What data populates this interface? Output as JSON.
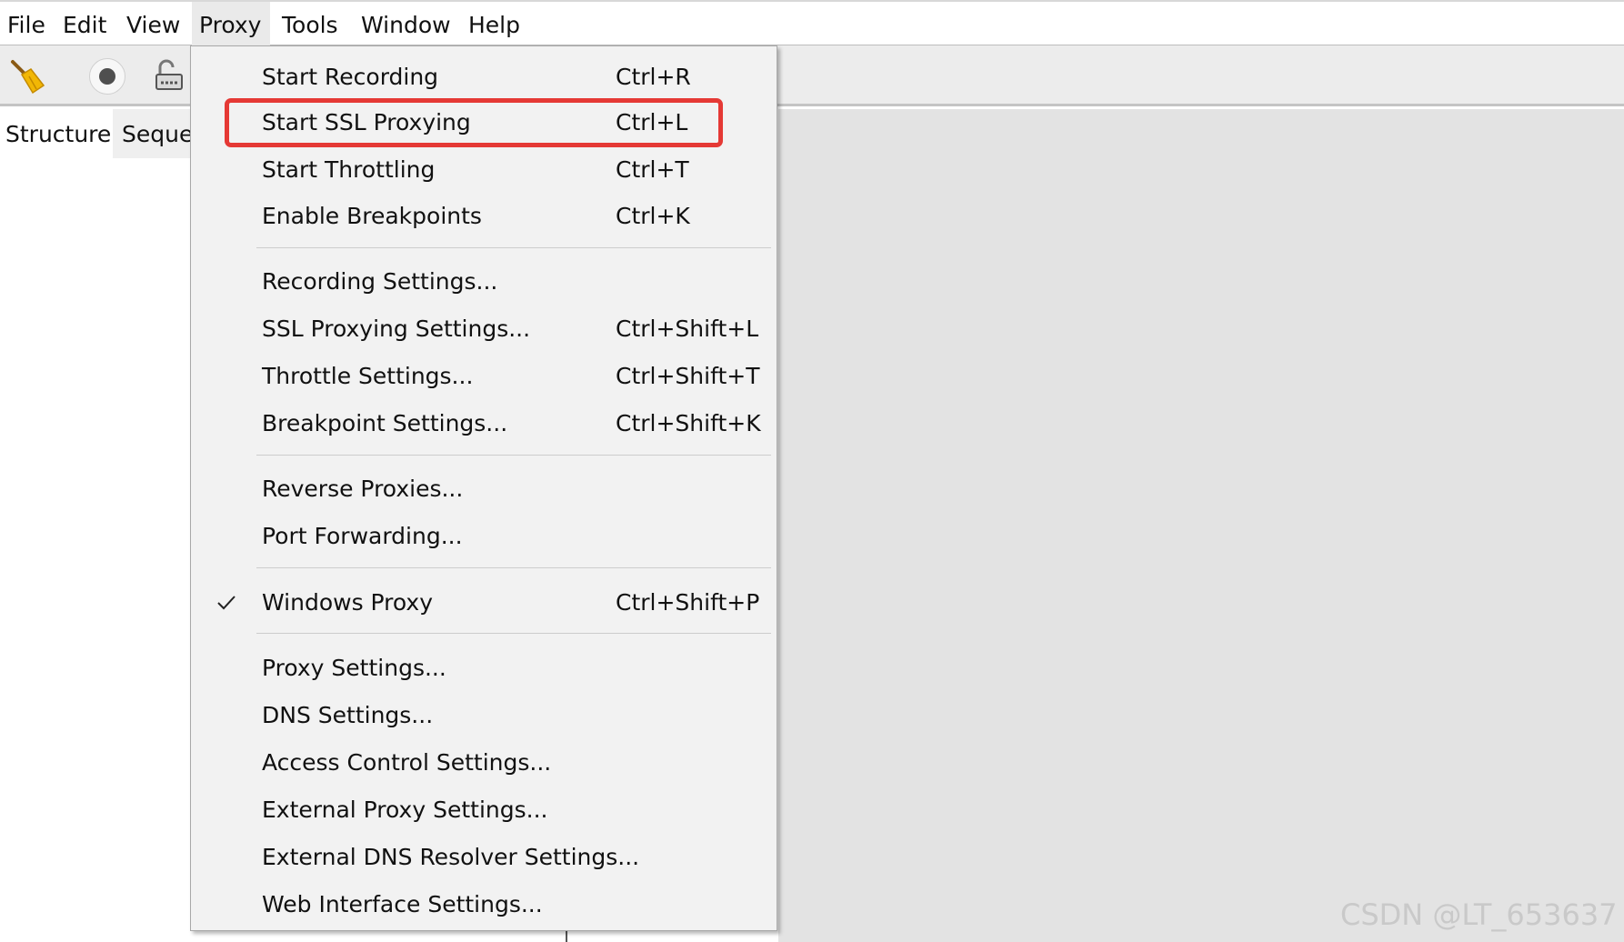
{
  "menubar": {
    "items": [
      {
        "label": "File"
      },
      {
        "label": "Edit"
      },
      {
        "label": "View"
      },
      {
        "label": "Proxy"
      },
      {
        "label": "Tools"
      },
      {
        "label": "Window"
      },
      {
        "label": "Help"
      }
    ],
    "open_item": "Proxy"
  },
  "toolbar": {
    "icons": [
      "broom-icon",
      "record-icon",
      "lock-icon"
    ]
  },
  "tabs": [
    {
      "label": "Structure"
    },
    {
      "label": "Sequer"
    }
  ],
  "dropdown": {
    "items": [
      {
        "label": "Start Recording",
        "shortcut": "Ctrl+R"
      },
      {
        "label": "Start SSL Proxying",
        "shortcut": "Ctrl+L",
        "highlighted": true
      },
      {
        "label": "Start Throttling",
        "shortcut": "Ctrl+T"
      },
      {
        "label": "Enable Breakpoints",
        "shortcut": "Ctrl+K"
      },
      {
        "label": "Recording Settings...",
        "shortcut": ""
      },
      {
        "label": "SSL Proxying Settings...",
        "shortcut": "Ctrl+Shift+L"
      },
      {
        "label": "Throttle Settings...",
        "shortcut": "Ctrl+Shift+T"
      },
      {
        "label": "Breakpoint Settings...",
        "shortcut": "Ctrl+Shift+K"
      },
      {
        "label": "Reverse Proxies...",
        "shortcut": ""
      },
      {
        "label": "Port Forwarding...",
        "shortcut": ""
      },
      {
        "label": "Windows Proxy",
        "shortcut": "Ctrl+Shift+P",
        "checked": true
      },
      {
        "label": "Proxy Settings...",
        "shortcut": ""
      },
      {
        "label": "DNS Settings...",
        "shortcut": ""
      },
      {
        "label": "Access Control Settings...",
        "shortcut": ""
      },
      {
        "label": "External Proxy Settings...",
        "shortcut": ""
      },
      {
        "label": "External DNS Resolver Settings...",
        "shortcut": ""
      },
      {
        "label": "Web Interface Settings...",
        "shortcut": ""
      }
    ]
  },
  "watermark": "CSDN @LT_653637",
  "colors": {
    "highlight_border": "#e53935",
    "menu_background": "#f2f2f2",
    "toolbar_background": "#ececec"
  }
}
